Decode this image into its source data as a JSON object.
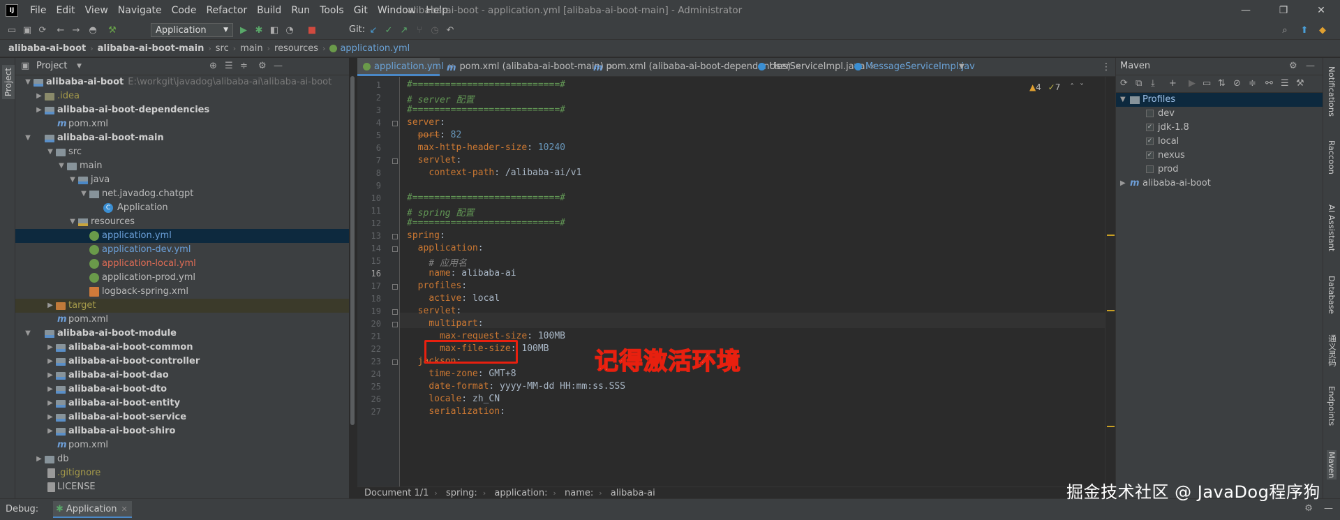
{
  "window": {
    "title": "alibaba-ai-boot - application.yml [alibaba-ai-boot-main] - Administrator",
    "logo_text": "IJ",
    "menu": [
      "File",
      "Edit",
      "View",
      "Navigate",
      "Code",
      "Refactor",
      "Build",
      "Run",
      "Tools",
      "Git",
      "Window",
      "Help"
    ]
  },
  "toolbar": {
    "run_config": "Application",
    "git_label": "Git:"
  },
  "breadcrumb": [
    "alibaba-ai-boot",
    "alibaba-ai-boot-main",
    "src",
    "main",
    "resources",
    "application.yml"
  ],
  "left_stripe": {
    "project_label": "Project"
  },
  "project_panel": {
    "title": "Project",
    "tree": [
      {
        "label": "alibaba-ai-boot",
        "path": "E:\\workgit\\javadog\\alibaba-ai\\alibaba-ai-boot"
      },
      {
        "label": ".idea"
      },
      {
        "label": "alibaba-ai-boot-dependencies"
      },
      {
        "label": "pom.xml"
      },
      {
        "label": "alibaba-ai-boot-main"
      },
      {
        "label": "src"
      },
      {
        "label": "main"
      },
      {
        "label": "java"
      },
      {
        "label": "net.javadog.chatgpt"
      },
      {
        "label": "Application"
      },
      {
        "label": "resources"
      },
      {
        "label": "application.yml"
      },
      {
        "label": "application-dev.yml"
      },
      {
        "label": "application-local.yml"
      },
      {
        "label": "application-prod.yml"
      },
      {
        "label": "logback-spring.xml"
      },
      {
        "label": "target"
      },
      {
        "label": "pom.xml"
      },
      {
        "label": "alibaba-ai-boot-module"
      },
      {
        "label": "alibaba-ai-boot-common"
      },
      {
        "label": "alibaba-ai-boot-controller"
      },
      {
        "label": "alibaba-ai-boot-dao"
      },
      {
        "label": "alibaba-ai-boot-dto"
      },
      {
        "label": "alibaba-ai-boot-entity"
      },
      {
        "label": "alibaba-ai-boot-service"
      },
      {
        "label": "alibaba-ai-boot-shiro"
      },
      {
        "label": "pom.xml"
      },
      {
        "label": "db"
      },
      {
        "label": ".gitignore"
      },
      {
        "label": "LICENSE"
      }
    ]
  },
  "editor": {
    "tabs": [
      {
        "label": "application.yml"
      },
      {
        "label": "pom.xml (alibaba-ai-boot-main)"
      },
      {
        "label": "pom.xml (alibaba-ai-boot-dependencies)"
      },
      {
        "label": "UserServiceImpl.java"
      },
      {
        "label": "MessageServiceImpl.jav"
      }
    ],
    "inspections": {
      "warnings": "4",
      "weak_warnings": "7"
    },
    "lines": [
      "#===========================#",
      "# server 配置",
      "#===========================#",
      "server:",
      "  port: 82",
      "  max-http-header-size: 10240",
      "  servlet:",
      "    context-path: /alibaba-ai/v1",
      "",
      "#===========================#",
      "# spring 配置",
      "#===========================#",
      "spring:",
      "  application:",
      "    # 应用名",
      "    name: alibaba-ai",
      "  profiles:",
      "    active: local",
      "  servlet:",
      "    multipart:",
      "      max-request-size: 100MB",
      "      max-file-size: 100MB",
      "  jackson:",
      "    time-zone: GMT+8",
      "    date-format: yyyy-MM-dd HH:mm:ss.SSS",
      "    locale: zh_CN",
      "    serialization:"
    ],
    "current_line": 16,
    "annotation": "记得激活环境",
    "structure_crumb": [
      "Document 1/1",
      "spring:",
      "application:",
      "name:",
      "alibaba-ai"
    ]
  },
  "maven": {
    "title": "Maven",
    "profiles_label": "Profiles",
    "profiles": [
      {
        "name": "dev",
        "checked": false
      },
      {
        "name": "jdk-1.8",
        "checked": true
      },
      {
        "name": "local",
        "checked": true
      },
      {
        "name": "nexus",
        "checked": true
      },
      {
        "name": "prod",
        "checked": false
      }
    ],
    "project": "alibaba-ai-boot"
  },
  "right_stripe": [
    "Notifications",
    "Raccoon",
    "AI Assistant",
    "Database",
    "通义灵码",
    "Endpoints",
    "Maven"
  ],
  "debug": {
    "label": "Debug:",
    "tab": "Application",
    "watermark": "掘金技术社区 @ JavaDog程序狗"
  },
  "colors": {
    "accent": "#4a88c7",
    "annotation_red": "#e8200f",
    "keyword": "#cc7832",
    "comment": "#808080"
  }
}
